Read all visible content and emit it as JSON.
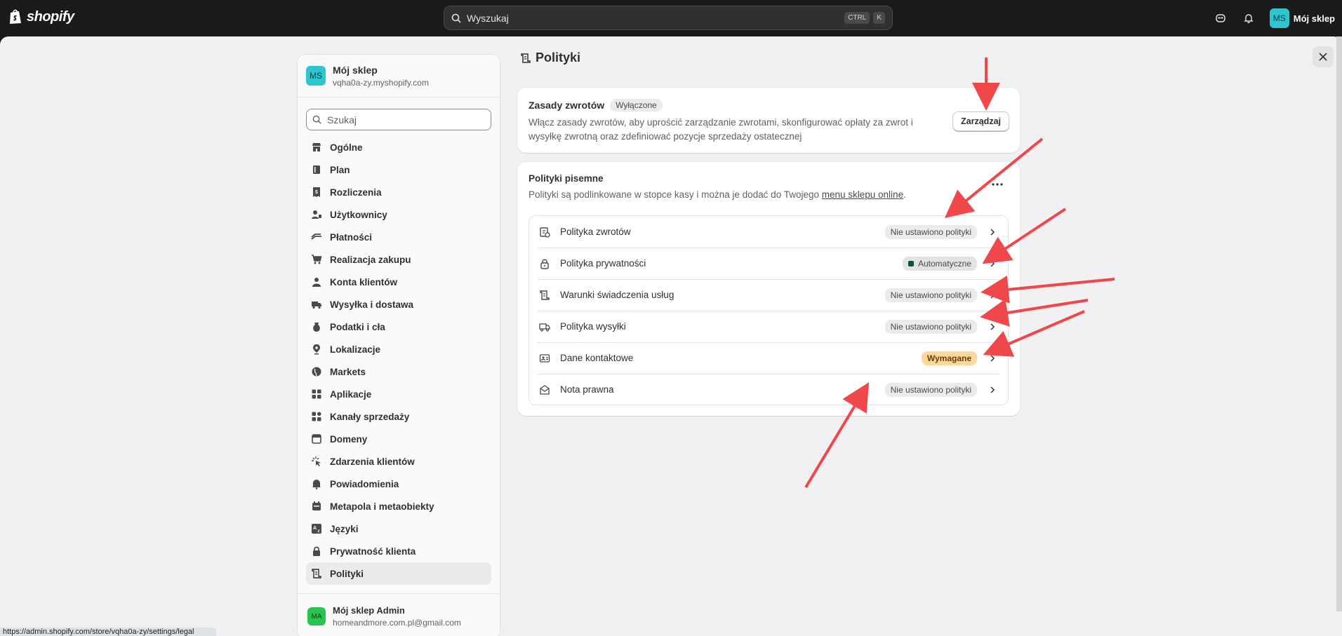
{
  "topbar": {
    "logo_text": "shopify",
    "search_placeholder": "Wyszukaj",
    "kbd_ctrl": "CTRL",
    "kbd_k": "K",
    "store_initials": "MS",
    "store_name": "Mój sklep"
  },
  "sidebar": {
    "store_initials": "MS",
    "store_name": "Mój sklep",
    "store_domain": "vqha0a-zy.myshopify.com",
    "search_placeholder": "Szukaj",
    "items": [
      {
        "label": "Ogólne",
        "icon": "store-icon"
      },
      {
        "label": "Plan",
        "icon": "plan-icon"
      },
      {
        "label": "Rozliczenia",
        "icon": "billing-icon"
      },
      {
        "label": "Użytkownicy",
        "icon": "users-icon"
      },
      {
        "label": "Płatności",
        "icon": "payments-icon"
      },
      {
        "label": "Realizacja zakupu",
        "icon": "cart-icon"
      },
      {
        "label": "Konta klientów",
        "icon": "person-icon"
      },
      {
        "label": "Wysyłka i dostawa",
        "icon": "truck-icon"
      },
      {
        "label": "Podatki i cła",
        "icon": "tax-icon"
      },
      {
        "label": "Lokalizacje",
        "icon": "location-icon"
      },
      {
        "label": "Markets",
        "icon": "globe-icon"
      },
      {
        "label": "Aplikacje",
        "icon": "apps-icon"
      },
      {
        "label": "Kanały sprzedaży",
        "icon": "channels-icon"
      },
      {
        "label": "Domeny",
        "icon": "domain-icon"
      },
      {
        "label": "Zdarzenia klientów",
        "icon": "events-icon"
      },
      {
        "label": "Powiadomienia",
        "icon": "bell-icon"
      },
      {
        "label": "Metapola i metaobiekty",
        "icon": "metafields-icon"
      },
      {
        "label": "Języki",
        "icon": "languages-icon"
      },
      {
        "label": "Prywatność klienta",
        "icon": "lock-icon"
      },
      {
        "label": "Polityki",
        "icon": "policy-icon",
        "active": true
      }
    ],
    "footer": {
      "initials": "MA",
      "name": "Mój sklep Admin",
      "email": "homeandmore.com.pl@gmail.com"
    }
  },
  "page": {
    "title": "Polityki"
  },
  "returns_card": {
    "title": "Zasady zwrotów",
    "badge": "Wyłączone",
    "description": "Włącz zasady zwrotów, aby uprościć zarządzanie zwrotami, skonfigurować opłaty za zwrot i wysyłkę zwrotną oraz zdefiniować pozycje sprzedaży ostatecznej",
    "button": "Zarządzaj"
  },
  "written_card": {
    "title": "Polityki pisemne",
    "description_prefix": "Polityki są podlinkowane w stopce kasy i można je dodać do Twojego ",
    "description_link": "menu sklepu online",
    "description_suffix": ".",
    "policies": [
      {
        "label": "Polityka zwrotów",
        "status": "Nie ustawiono polityki",
        "kind": "neutral",
        "icon": "return-policy-icon"
      },
      {
        "label": "Polityka prywatności",
        "status": "Automatyczne",
        "kind": "ok",
        "icon": "lock-icon"
      },
      {
        "label": "Warunki świadczenia usług",
        "status": "Nie ustawiono polityki",
        "kind": "neutral",
        "icon": "terms-icon"
      },
      {
        "label": "Polityka wysyłki",
        "status": "Nie ustawiono polityki",
        "kind": "neutral",
        "icon": "shipping-icon"
      },
      {
        "label": "Dane kontaktowe",
        "status": "Wymagane",
        "kind": "warn",
        "icon": "contact-card-icon"
      },
      {
        "label": "Nota prawna",
        "status": "Nie ustawiono polityki",
        "kind": "neutral",
        "icon": "legal-notice-icon"
      }
    ]
  },
  "status_bar_url": "https://admin.shopify.com/store/vqha0a-zy/settings/legal",
  "colors": {
    "arrow": "#f0484a",
    "warn_badge": "#ffd79d",
    "avatar": "#2ec5ce"
  }
}
